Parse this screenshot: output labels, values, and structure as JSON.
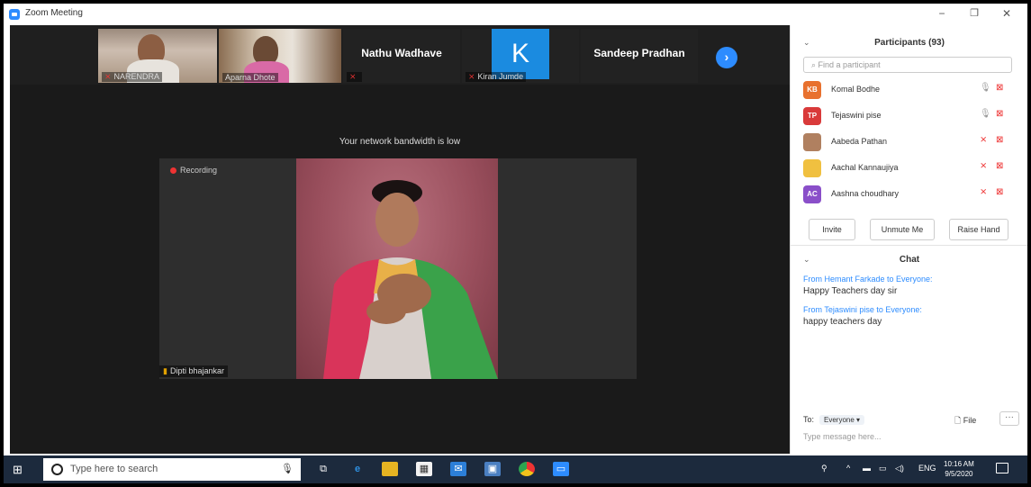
{
  "window": {
    "title": "Zoom Meeting",
    "minimize": "−",
    "maximize": "❐",
    "close": "✕"
  },
  "gallery": {
    "tiles": [
      {
        "name": "NARENDRA",
        "muted": true,
        "type": "video"
      },
      {
        "name": "Aparna Dhote",
        "muted": false,
        "type": "video"
      },
      {
        "name": "Nathu Wadhave",
        "muted": true,
        "type": "name"
      },
      {
        "name": "Kiran Jumde",
        "initial": "K",
        "muted": true,
        "type": "avatar"
      },
      {
        "name": "Sandeep Pradhan",
        "type": "name"
      }
    ],
    "next_icon": "›"
  },
  "notice": "Your network bandwidth is low",
  "main_video": {
    "recording_label": "Recording",
    "speaker": "Dipti bhajankar"
  },
  "participants": {
    "title": "Participants (93)",
    "search_placeholder": "Find a participant",
    "list": [
      {
        "initials": "KB",
        "color": "#e8712e",
        "name": "Komal Bodhe",
        "mic": "on",
        "video": "off"
      },
      {
        "initials": "TP",
        "color": "#d93a3a",
        "name": "Tejaswini pise",
        "mic": "on",
        "video": "off"
      },
      {
        "initials": "",
        "color": "#b08060",
        "name": "Aabeda Pathan",
        "mic": "off",
        "video": "off"
      },
      {
        "initials": "",
        "color": "#f0c040",
        "name": "Aachal Kannaujiya",
        "mic": "off",
        "video": "off"
      },
      {
        "initials": "AC",
        "color": "#8a4fc9",
        "name": "Aashna choudhary",
        "mic": "off",
        "video": "off"
      }
    ],
    "buttons": {
      "invite": "Invite",
      "unmute": "Unmute Me",
      "raise_hand": "Raise Hand"
    }
  },
  "chat": {
    "title": "Chat",
    "messages": [
      {
        "from": "From Hemant Farkade to Everyone:",
        "text": "Happy Teachers day sir"
      },
      {
        "from": "From Tejaswini pise to Everyone:",
        "text": "happy teachers day"
      }
    ],
    "to_label": "To:",
    "to_value": "Everyone ▾",
    "file_label": "File",
    "more_label": "···",
    "input_placeholder": "Type message here..."
  },
  "taskbar": {
    "search_placeholder": "Type here to search",
    "language": "ENG",
    "time": "10:16 AM",
    "date": "9/5/2020"
  },
  "colors": {
    "zoom_blue": "#2d8cff",
    "muted_red": "#e33333"
  }
}
